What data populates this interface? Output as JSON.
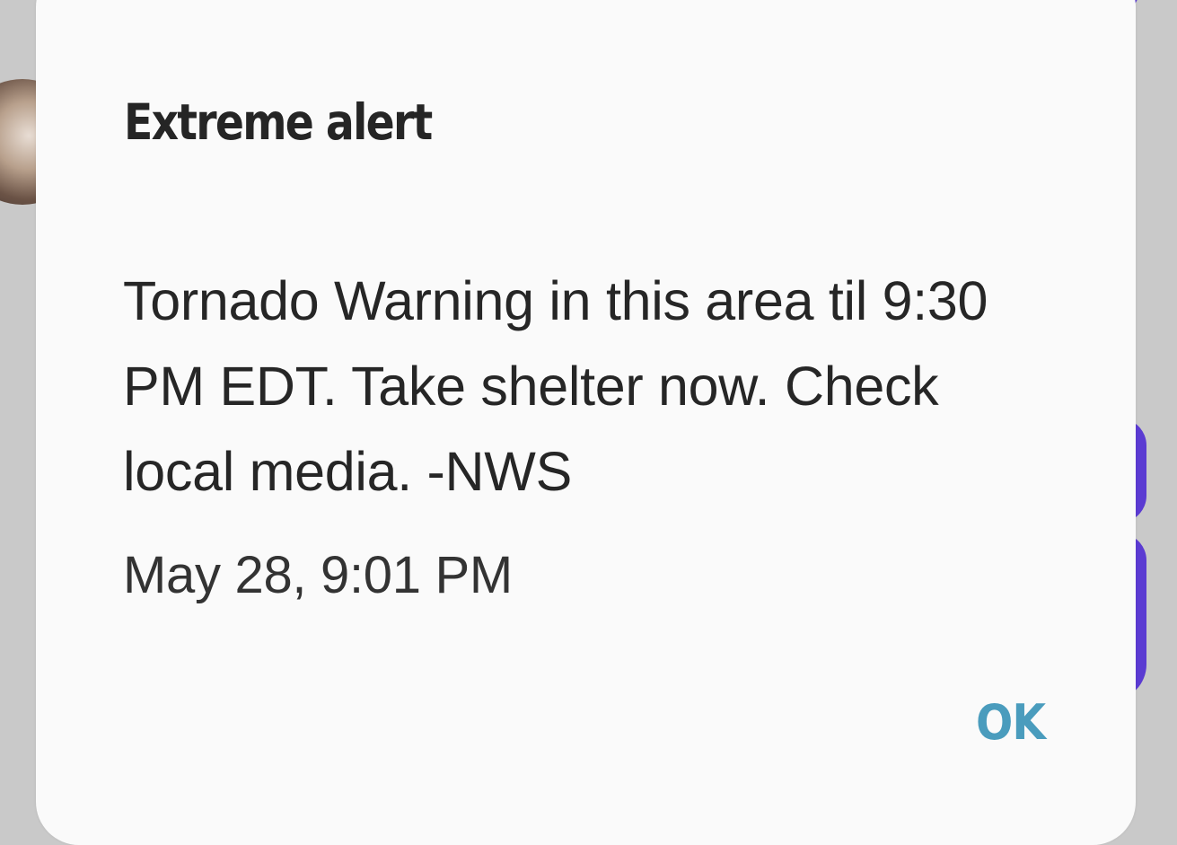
{
  "dialog": {
    "title": "Extreme alert",
    "message": "Tornado Warning in this area til 9:30 PM EDT. Take shelter now. Check local media. -NWS",
    "timestamp": "May 28, 9:01 PM",
    "ok_label": "OK"
  },
  "colors": {
    "accent": "#4a9cbd",
    "background_bubble": "#5b3bd2",
    "dialog_background": "#fafafa",
    "text": "#262626"
  }
}
